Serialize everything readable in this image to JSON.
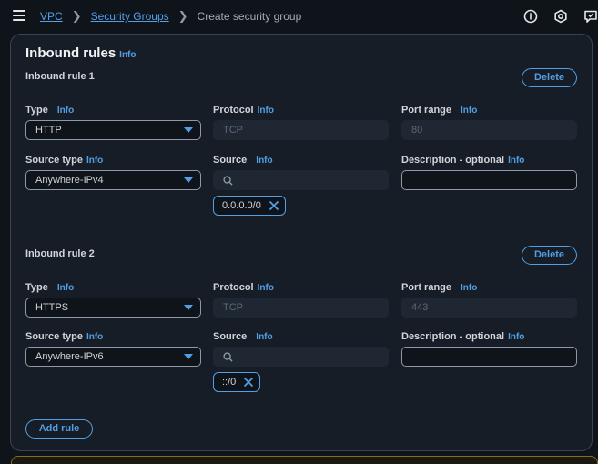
{
  "breadcrumb": {
    "items": [
      {
        "label": "VPC"
      },
      {
        "label": "Security Groups"
      },
      {
        "label": "Create security group"
      }
    ]
  },
  "top_icons": [
    "info-circle-icon",
    "settings-hexagon-icon",
    "feedback-icon"
  ],
  "panel": {
    "title": "Inbound rules",
    "info": "Info",
    "add_rule_label": "Add rule",
    "rules": [
      {
        "heading": "Inbound rule 1",
        "delete_label": "Delete",
        "type_label": "Type",
        "type_value": "HTTP",
        "protocol_label": "Protocol",
        "protocol_value": "TCP",
        "port_label": "Port range",
        "port_value": "80",
        "source_type_label": "Source type",
        "source_type_value": "Anywhere-IPv4",
        "source_label": "Source",
        "source_token": "0.0.0.0/0",
        "desc_label": "Description - optional",
        "desc_value": ""
      },
      {
        "heading": "Inbound rule 2",
        "delete_label": "Delete",
        "type_label": "Type",
        "type_value": "HTTPS",
        "protocol_label": "Protocol",
        "protocol_value": "TCP",
        "port_label": "Port range",
        "port_value": "443",
        "source_type_label": "Source type",
        "source_type_value": "Anywhere-IPv6",
        "source_label": "Source",
        "source_token": "::/0",
        "desc_label": "Description - optional",
        "desc_value": ""
      }
    ]
  },
  "colors": {
    "accent": "#539fe5",
    "background": "#0f141a",
    "panel": "#161d26"
  }
}
